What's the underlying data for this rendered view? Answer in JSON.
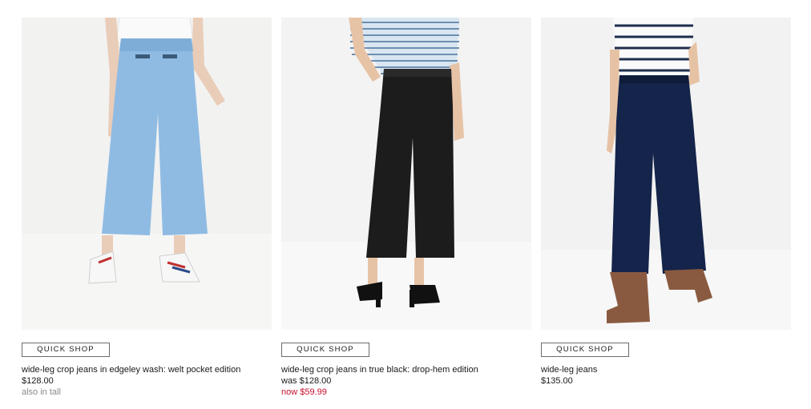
{
  "products": [
    {
      "image_alt": "wide-leg crop jeans in edgeley wash",
      "quick_shop_label": "QUICK SHOP",
      "name": "wide-leg crop jeans in edgeley wash: welt pocket edition",
      "price": "$128.00",
      "note": "also in tall"
    },
    {
      "image_alt": "wide-leg crop jeans in true black",
      "quick_shop_label": "QUICK SHOP",
      "name": "wide-leg crop jeans in true black: drop-hem edition",
      "was_price": "was $128.00",
      "now_price": "now $59.99"
    },
    {
      "image_alt": "wide-leg jeans",
      "quick_shop_label": "QUICK SHOP",
      "name": "wide-leg jeans",
      "price": "$135.00"
    }
  ],
  "colors": {
    "sale": "#c8102e",
    "muted": "#8a8a8a",
    "text": "#1a1a1a",
    "photo_bg": "#f1f1f0"
  }
}
